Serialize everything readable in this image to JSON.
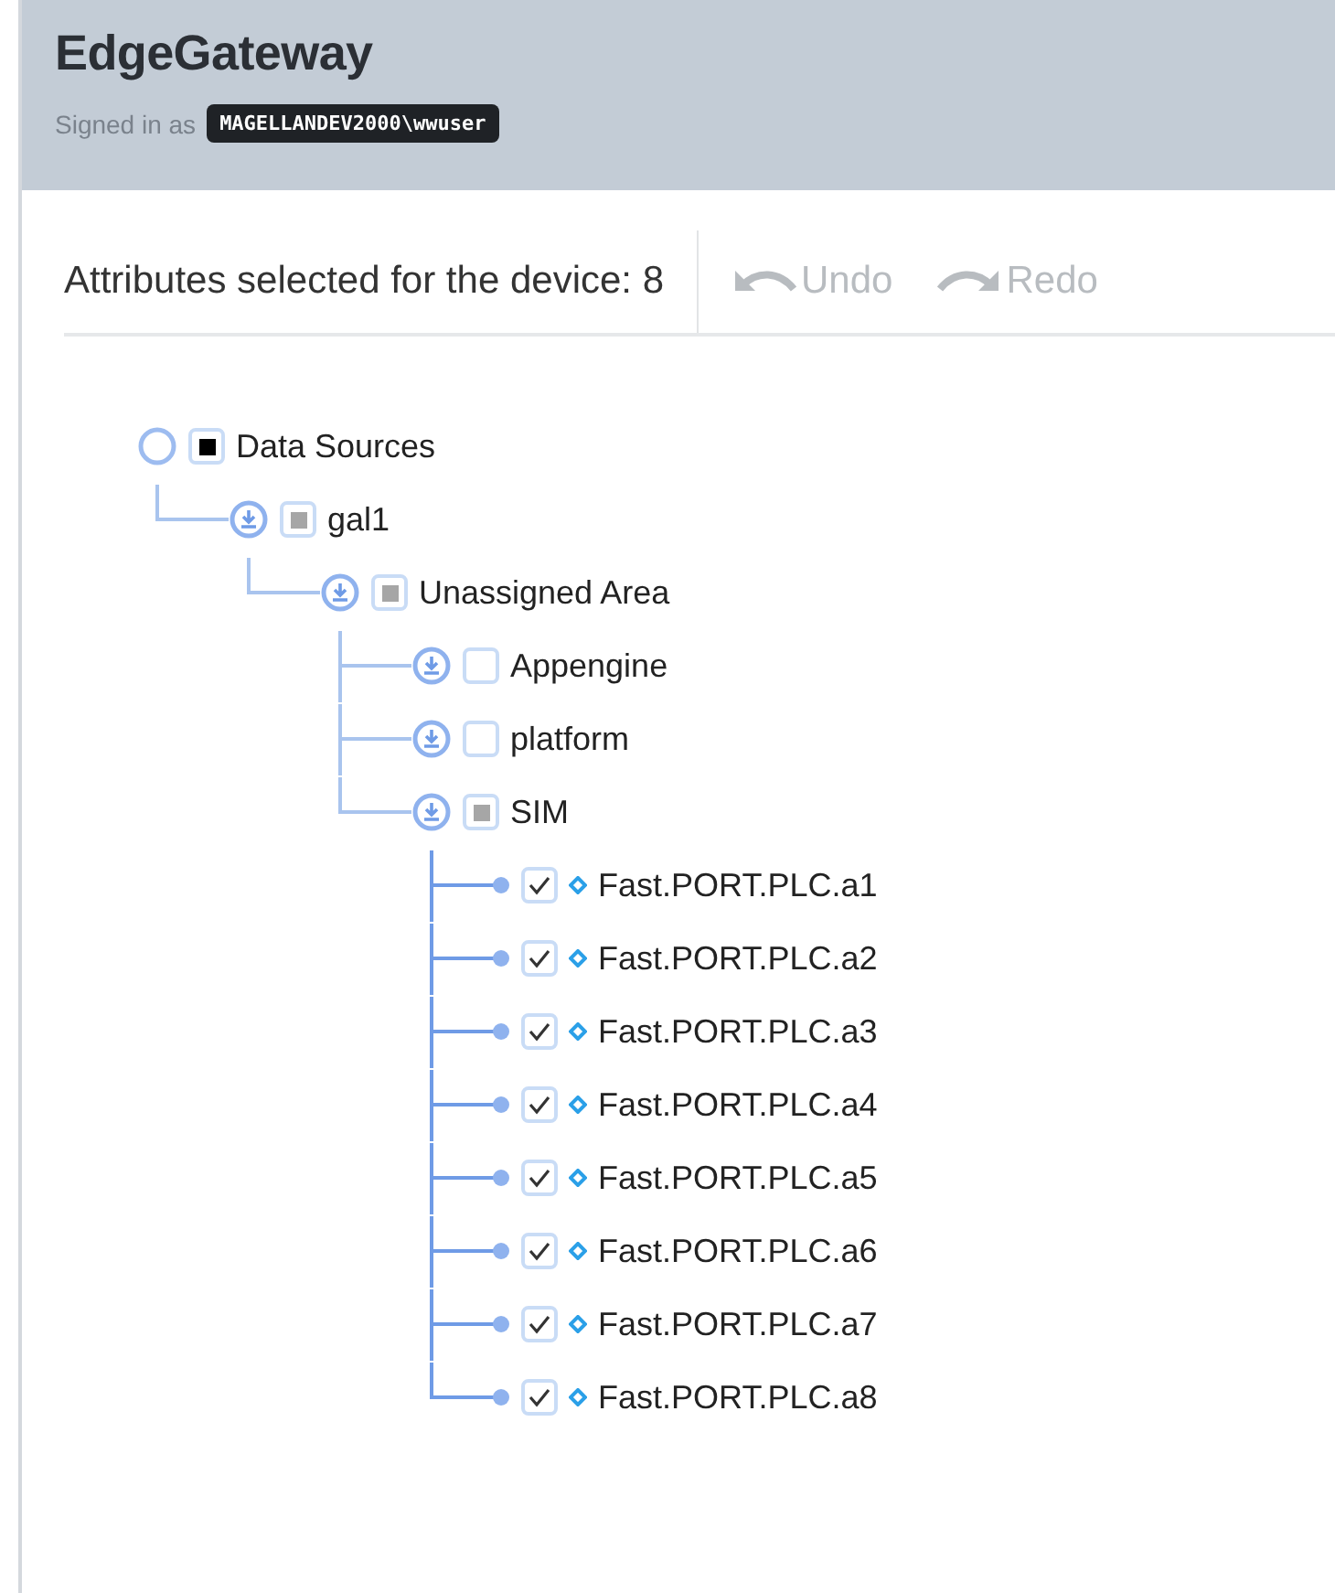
{
  "header": {
    "title": "EdgeGateway",
    "signed_in_label": "Signed in as",
    "user": "MAGELLANDEV2000\\wwuser"
  },
  "toolbar": {
    "summary": "Attributes selected for the device: 8",
    "actions": [
      {
        "kind": "undo",
        "label": "Undo",
        "disabled": true
      },
      {
        "kind": "redo",
        "label": "Redo",
        "disabled": true
      }
    ]
  },
  "tree": [
    {
      "kind": "root",
      "label": "Data Sources",
      "checked": false,
      "mixed": true,
      "children": [
        {
          "kind": "group",
          "label": "gal1",
          "checked": false,
          "mixed": true,
          "children": [
            {
              "kind": "group",
              "label": "Unassigned Area",
              "checked": false,
              "mixed": true,
              "children": [
                {
                  "kind": "group",
                  "label": "Appengine",
                  "checked": false,
                  "mixed": false
                },
                {
                  "kind": "group",
                  "label": "platform",
                  "checked": false,
                  "mixed": false
                },
                {
                  "kind": "group",
                  "label": "SIM",
                  "checked": false,
                  "mixed": true,
                  "children": [
                    {
                      "kind": "attribute",
                      "label": "Fast.PORT.PLC.a1",
                      "checked": true
                    },
                    {
                      "kind": "attribute",
                      "label": "Fast.PORT.PLC.a2",
                      "checked": true
                    },
                    {
                      "kind": "attribute",
                      "label": "Fast.PORT.PLC.a3",
                      "checked": true
                    },
                    {
                      "kind": "attribute",
                      "label": "Fast.PORT.PLC.a4",
                      "checked": true
                    },
                    {
                      "kind": "attribute",
                      "label": "Fast.PORT.PLC.a5",
                      "checked": true
                    },
                    {
                      "kind": "attribute",
                      "label": "Fast.PORT.PLC.a6",
                      "checked": true
                    },
                    {
                      "kind": "attribute",
                      "label": "Fast.PORT.PLC.a7",
                      "checked": true
                    },
                    {
                      "kind": "attribute",
                      "label": "Fast.PORT.PLC.a8",
                      "checked": true
                    }
                  ]
                }
              ]
            }
          ]
        }
      ]
    }
  ]
}
